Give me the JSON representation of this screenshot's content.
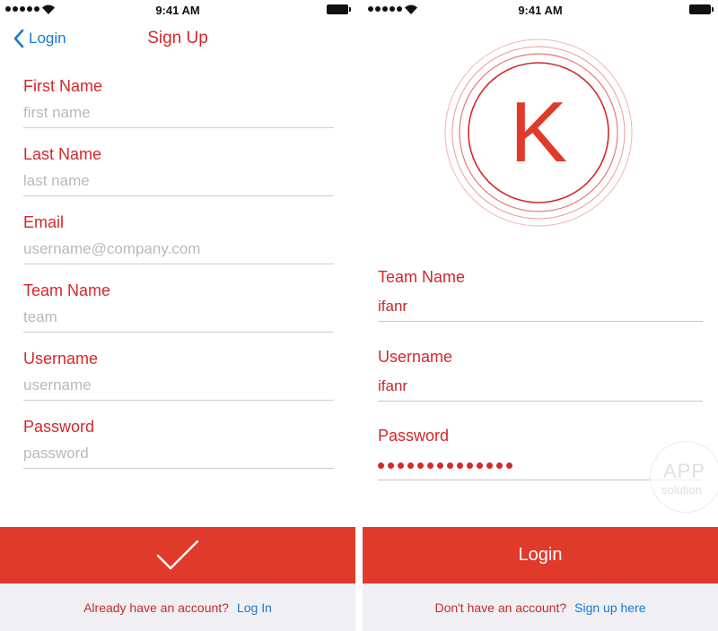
{
  "status_bar": {
    "time": "9:41 AM"
  },
  "signup": {
    "back_label": "Login",
    "title": "Sign Up",
    "fields": [
      {
        "label": "First Name",
        "placeholder": "first name"
      },
      {
        "label": "Last Name",
        "placeholder": "last name"
      },
      {
        "label": "Email",
        "placeholder": "username@company.com"
      },
      {
        "label": "Team Name",
        "placeholder": "team"
      },
      {
        "label": "Username",
        "placeholder": "username"
      },
      {
        "label": "Password",
        "placeholder": "password"
      }
    ],
    "submit_icon": "checkmark-icon",
    "footer_prompt": "Already have an account?",
    "footer_link": "Log In"
  },
  "login": {
    "logo_letter": "K",
    "fields": [
      {
        "label": "Team Name",
        "value": "ifanr"
      },
      {
        "label": "Username",
        "value": "ifanr"
      },
      {
        "label": "Password",
        "masked_length": 14
      }
    ],
    "button_label": "Login",
    "footer_prompt": "Don't have an account?",
    "footer_link": "Sign up here"
  },
  "watermark": {
    "line1": "APP",
    "line2": "solution"
  },
  "colors": {
    "accent_red": "#e03a2b",
    "label_red": "#d4282a",
    "link_blue": "#1a7ad0",
    "footer_bg": "#efeff4",
    "placeholder_gray": "#b9b9b9"
  }
}
